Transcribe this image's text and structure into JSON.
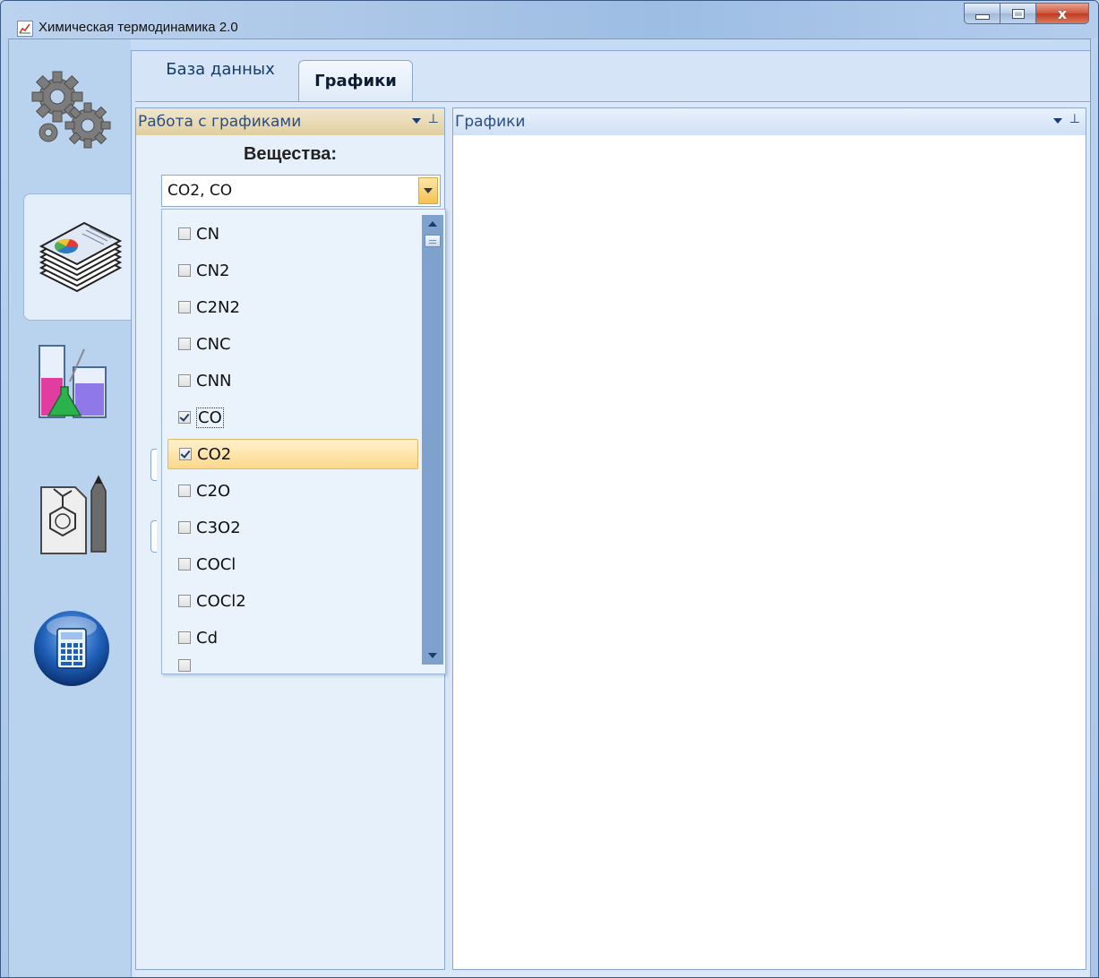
{
  "window": {
    "title": "Химическая термодинамика 2.0",
    "close_glyph": "x"
  },
  "sidebar": {
    "items": [
      {
        "name": "settings",
        "icon": "gears-icon"
      },
      {
        "name": "graphs",
        "icon": "charts-stack-icon",
        "selected": true
      },
      {
        "name": "chemistry",
        "icon": "beakers-icon"
      },
      {
        "name": "structure-editor",
        "icon": "molecule-pencil-icon"
      },
      {
        "name": "calculator",
        "icon": "calculator-icon"
      }
    ]
  },
  "tabs": [
    {
      "label": "База данных",
      "active": false
    },
    {
      "label": "Графики",
      "active": true
    }
  ],
  "left_panel": {
    "title": "Работа с графиками",
    "substances_label": "Вещества:",
    "combo_value": "CO2, CO",
    "options": [
      {
        "label": "CN",
        "checked": false
      },
      {
        "label": "CN2",
        "checked": false
      },
      {
        "label": "C2N2",
        "checked": false
      },
      {
        "label": "CNC",
        "checked": false
      },
      {
        "label": "CNN",
        "checked": false
      },
      {
        "label": "CO",
        "checked": true,
        "focused": true
      },
      {
        "label": "CO2",
        "checked": true,
        "highlighted": true
      },
      {
        "label": "C2O",
        "checked": false
      },
      {
        "label": "C3O2",
        "checked": false
      },
      {
        "label": "COCl",
        "checked": false
      },
      {
        "label": "COCl2",
        "checked": false
      },
      {
        "label": "Cd",
        "checked": false
      }
    ]
  },
  "right_panel": {
    "title": "Графики"
  },
  "colors": {
    "accent": "#fcd88a",
    "panel_header_left": "#e1cf9e",
    "frame": "#8aa8cf"
  }
}
